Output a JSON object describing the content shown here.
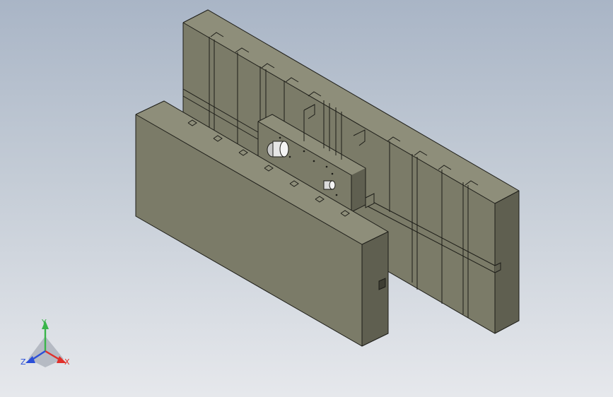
{
  "viewport": {
    "background_top": "#a9b5c6",
    "background_bottom": "#e6e8ec"
  },
  "model": {
    "face_color": "#7b7b68",
    "edge_color": "#1d1d18"
  },
  "triad": {
    "x_label": "X",
    "y_label": "Y",
    "z_label": "Z",
    "x_color": "#e0302b",
    "y_color": "#39b54a",
    "z_color": "#2b4fd8"
  }
}
